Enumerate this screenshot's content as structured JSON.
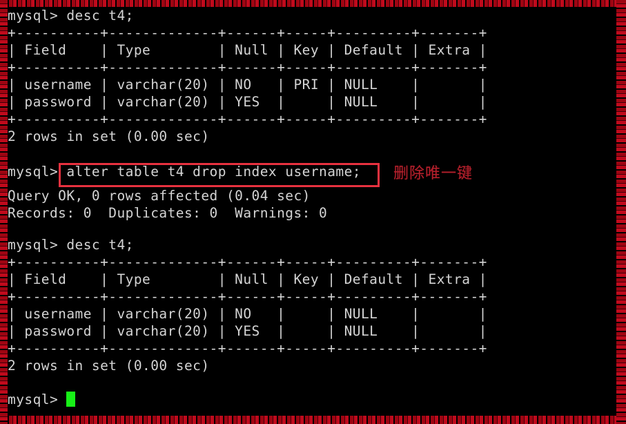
{
  "terminal": {
    "prompt": "mysql>",
    "foreground_color": "#d4d4d4",
    "background_color": "#000000",
    "cursor_color": "#17f017",
    "lines": [
      "mysql> desc t4;",
      "+----------+-------------+------+-----+---------+-------+",
      "| Field    | Type        | Null | Key | Default | Extra |",
      "+----------+-------------+------+-----+---------+-------+",
      "| username | varchar(20) | NO   | PRI | NULL    |       |",
      "| password | varchar(20) | YES  |     | NULL    |       |",
      "+----------+-------------+------+-----+---------+-------+",
      "2 rows in set (0.00 sec)",
      "",
      "mysql> alter table t4 drop index username;",
      "Query OK, 0 rows affected (0.04 sec)",
      "Records: 0  Duplicates: 0  Warnings: 0",
      "",
      "mysql> desc t4;",
      "+----------+-------------+------+-----+---------+-------+",
      "| Field    | Type        | Null | Key | Default | Extra |",
      "+----------+-------------+------+-----+---------+-------+",
      "| username | varchar(20) | NO   |     | NULL    |       |",
      "| password | varchar(20) | YES  |     | NULL    |       |",
      "+----------+-------------+------+-----+---------+-------+",
      "2 rows in set (0.00 sec)",
      "",
      "mysql> "
    ]
  },
  "highlight": {
    "command": "alter table t4 drop index username;",
    "border_color": "#e8313f"
  },
  "annotation": {
    "text": "删除唯一键",
    "color": "#b3202c"
  },
  "frame": {
    "stripe_color": "#c00a1c",
    "stripe_dark_color": "#9e0512"
  },
  "tables": [
    {
      "name": "desc-t4-before",
      "columns": [
        "Field",
        "Type",
        "Null",
        "Key",
        "Default",
        "Extra"
      ],
      "rows": [
        [
          "username",
          "varchar(20)",
          "NO",
          "PRI",
          "NULL",
          ""
        ],
        [
          "password",
          "varchar(20)",
          "YES",
          "",
          "NULL",
          ""
        ]
      ],
      "footer": "2 rows in set (0.00 sec)"
    },
    {
      "name": "desc-t4-after",
      "columns": [
        "Field",
        "Type",
        "Null",
        "Key",
        "Default",
        "Extra"
      ],
      "rows": [
        [
          "username",
          "varchar(20)",
          "NO",
          "",
          "NULL",
          ""
        ],
        [
          "password",
          "varchar(20)",
          "YES",
          "",
          "NULL",
          ""
        ]
      ],
      "footer": "2 rows in set (0.00 sec)"
    }
  ],
  "query_result": {
    "status": "Query OK, 0 rows affected (0.04 sec)",
    "details": "Records: 0  Duplicates: 0  Warnings: 0"
  }
}
